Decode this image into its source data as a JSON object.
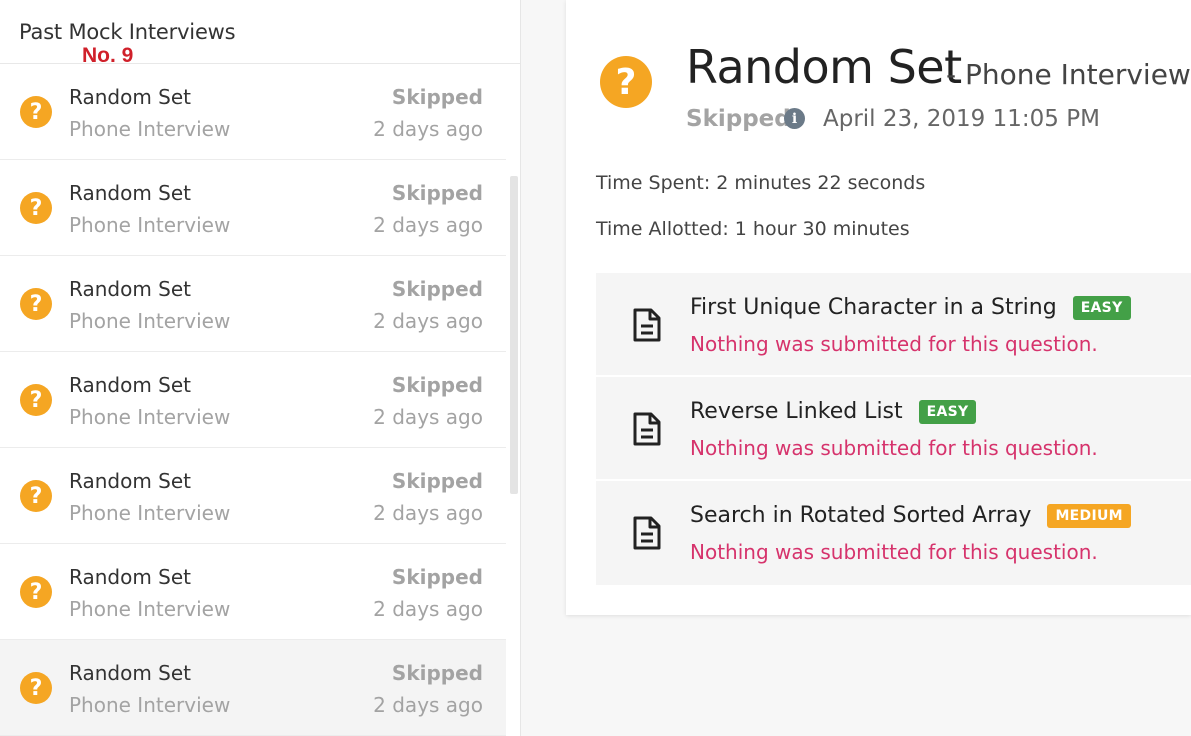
{
  "sidebar": {
    "title": "Past Mock Interviews",
    "annotation": "No. 9",
    "items": [
      {
        "title": "Random Set",
        "subtitle": "Phone Interview",
        "status": "Skipped",
        "time": "2 days ago"
      },
      {
        "title": "Random Set",
        "subtitle": "Phone Interview",
        "status": "Skipped",
        "time": "2 days ago"
      },
      {
        "title": "Random Set",
        "subtitle": "Phone Interview",
        "status": "Skipped",
        "time": "2 days ago"
      },
      {
        "title": "Random Set",
        "subtitle": "Phone Interview",
        "status": "Skipped",
        "time": "2 days ago"
      },
      {
        "title": "Random Set",
        "subtitle": "Phone Interview",
        "status": "Skipped",
        "time": "2 days ago"
      },
      {
        "title": "Random Set",
        "subtitle": "Phone Interview",
        "status": "Skipped",
        "time": "2 days ago"
      },
      {
        "title": "Random Set",
        "subtitle": "Phone Interview",
        "status": "Skipped",
        "time": "2 days ago"
      }
    ],
    "item_icon": "question-circle-icon",
    "selected_index": 6
  },
  "detail": {
    "icon": "question-circle-icon",
    "title": "Random Set",
    "subtitle": "- Phone Interview",
    "status": "Skipped",
    "date": "April 23, 2019 11:05 PM",
    "time_spent": "Time Spent: 2 minutes 22 seconds",
    "time_allotted": "Time Allotted: 1 hour 30 minutes",
    "questions": [
      {
        "title": "First Unique Character in a String",
        "difficulty": "EASY",
        "note": "Nothing was submitted for this question."
      },
      {
        "title": "Reverse Linked List",
        "difficulty": "EASY",
        "note": "Nothing was submitted for this question."
      },
      {
        "title": "Search in Rotated Sorted Array",
        "difficulty": "MEDIUM",
        "note": "Nothing was submitted for this question."
      }
    ]
  },
  "colors": {
    "accent_orange": "#f5a623",
    "easy_green": "#43a047",
    "medium_orange": "#f5a623",
    "note_pink": "#d6336c",
    "annotation_red": "#d0202a"
  }
}
